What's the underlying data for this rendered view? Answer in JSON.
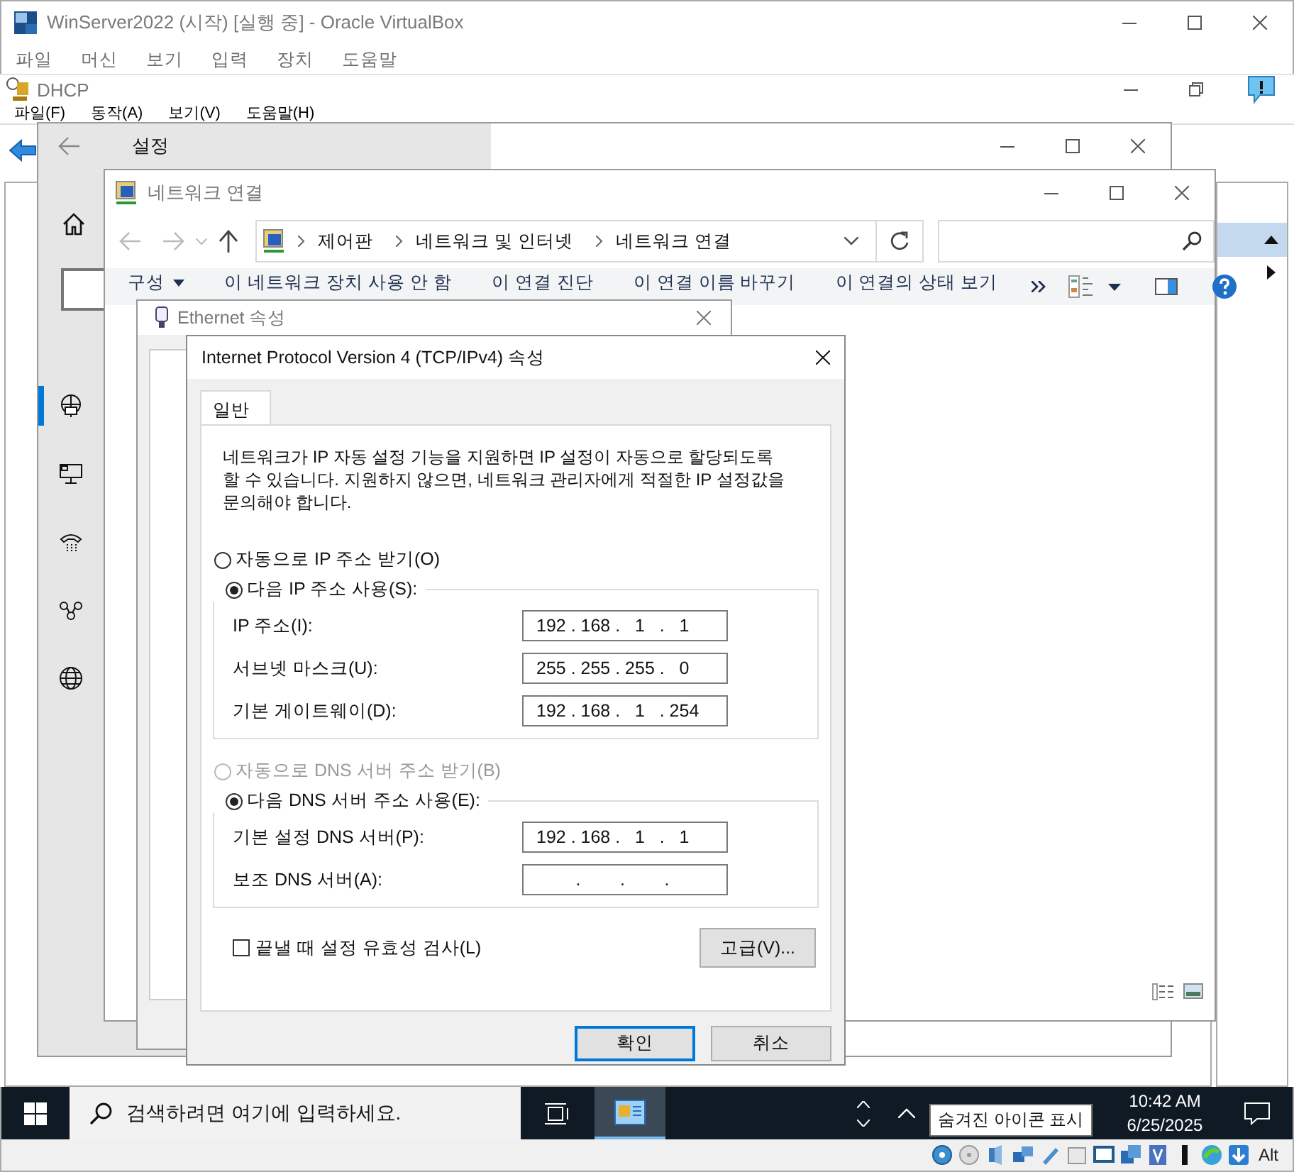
{
  "virtualbox": {
    "title": "WinServer2022 (시작) [실행 중] - Oracle VirtualBox",
    "menu": [
      "파일",
      "머신",
      "보기",
      "입력",
      "장치",
      "도움말"
    ],
    "host_key": "Alt"
  },
  "dhcp": {
    "title": "DHCP",
    "menu": [
      "파일(F)",
      "동작(A)",
      "보기(V)",
      "도움말(H)"
    ]
  },
  "settings": {
    "title": "설정",
    "nav": [
      {
        "kind": "network",
        "selected": true
      },
      {
        "kind": "monitor",
        "selected": false
      },
      {
        "kind": "phone",
        "selected": false
      },
      {
        "kind": "link",
        "selected": false
      },
      {
        "kind": "globe",
        "selected": false
      }
    ]
  },
  "network_connections": {
    "title": "네트워크 연결",
    "breadcrumb": [
      "제어판",
      "네트워크 및 인터넷",
      "네트워크 연결"
    ],
    "toolbar": [
      {
        "label": "구성",
        "kind": "dropdown"
      },
      {
        "label": "이 네트워크 장치 사용 안 함",
        "kind": "action"
      },
      {
        "label": "이 연결 진단",
        "kind": "action"
      },
      {
        "label": "이 연결 이름 바꾸기",
        "kind": "action"
      },
      {
        "label": "이 연결의 상태 보기",
        "kind": "action"
      }
    ]
  },
  "ethernet_properties": {
    "title": "Ethernet 속성"
  },
  "ipv4_dialog": {
    "title": "Internet Protocol Version 4 (TCP/IPv4) 속성",
    "tabs": [
      {
        "label": "일반",
        "selected": true
      }
    ],
    "description": "네트워크가 IP 자동 설정 기능을 지원하면 IP 설정이 자동으로 할당되도록 할 수 있습니다. 지원하지 않으면, 네트워크 관리자에게 적절한 IP 설정값을 문의해야 합니다.",
    "ip_mode": [
      {
        "label": "자동으로 IP 주소 받기(O)",
        "selected": false,
        "disabled": false
      },
      {
        "label": "다음 IP 주소 사용(S):",
        "selected": true,
        "disabled": false
      }
    ],
    "ip_fields": [
      {
        "label": "IP 주소(I):",
        "value": "192 . 168 .   1   .   1"
      },
      {
        "label": "서브넷 마스크(U):",
        "value": "255 . 255 . 255 .   0"
      },
      {
        "label": "기본 게이트웨이(D):",
        "value": "192 . 168 .   1   . 254"
      }
    ],
    "dns_mode": [
      {
        "label": "자동으로 DNS 서버 주소 받기(B)",
        "selected": false,
        "disabled": true
      },
      {
        "label": "다음 DNS 서버 주소 사용(E):",
        "selected": true,
        "disabled": false
      }
    ],
    "dns_fields": [
      {
        "label": "기본 설정 DNS 서버(P):",
        "value": "192 . 168 .   1   .   1"
      },
      {
        "label": "보조 DNS 서버(A):",
        "value": "        .        .        ."
      }
    ],
    "validate": {
      "label": "끝낼 때 설정 유효성 검사(L)",
      "checked": false
    },
    "advanced_button": "고급(V)...",
    "buttons": [
      {
        "label": "확인",
        "default": true
      },
      {
        "label": "취소",
        "default": false
      }
    ]
  },
  "taskbar": {
    "search_placeholder": "검색하려면 여기에 입력하세요.",
    "tooltip": "숨겨진 아이콘 표시",
    "time": "10:42 AM",
    "date": "6/25/2025"
  }
}
